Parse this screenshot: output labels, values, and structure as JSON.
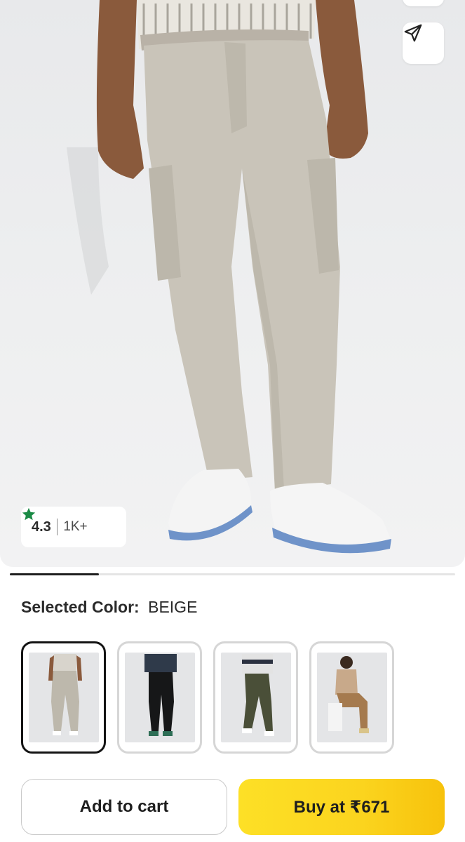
{
  "product": {
    "image_alt": "Man wearing beige cargo trousers and white sneakers",
    "rating": "4.3",
    "rating_count": "1K+"
  },
  "gallery": {
    "progress": 0.2
  },
  "selection": {
    "label": "Selected Color:",
    "value": "BEIGE"
  },
  "swatches": [
    {
      "name": "beige",
      "selected": true
    },
    {
      "name": "black",
      "selected": false
    },
    {
      "name": "olive",
      "selected": false
    },
    {
      "name": "brown",
      "selected": false
    }
  ],
  "actions": {
    "add_to_cart": "Add to cart",
    "buy": "Buy at ₹671"
  },
  "icons": {
    "share": "share-icon",
    "star": "star-icon"
  },
  "colors": {
    "star": "#1a8a45",
    "buy_button": "#fcd91f",
    "selected_border": "#141414"
  }
}
